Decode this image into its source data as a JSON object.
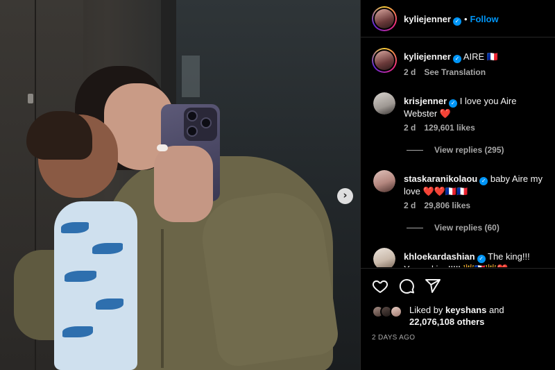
{
  "post": {
    "author": "kyliejenner",
    "follow_label": "Follow",
    "separator": "•",
    "verified_glyph": "✓",
    "caption": {
      "username": "kyliejenner",
      "text": "AIRE 🇫🇷",
      "age": "2 d",
      "translation_label": "See Translation"
    },
    "comments": [
      {
        "username": "krisjenner",
        "text": "I love you Aire Webster ❤️",
        "age": "2 d",
        "likes": "129,601 likes",
        "replies": "View replies (295)",
        "avatar_color": "#cfcac6"
      },
      {
        "username": "staskaranikolaou",
        "text": "baby Aire my love ❤️❤️🇫🇷🇫🇷",
        "age": "2 d",
        "likes": "29,806 likes",
        "replies": "View replies (60)",
        "avatar_color": "#b98b84"
      },
      {
        "username": "khloekardashian",
        "text": "The king!!! Young king!!!!! 👑🇫🇷👑❤️",
        "avatar_color": "#d9cfc6"
      }
    ],
    "liked_by_prefix": "Liked by",
    "liked_by_user": "keyshans",
    "liked_by_conj": "and",
    "others_count": "22,076,108 others",
    "time_ago": "2 DAYS AGO",
    "next_arrow": "›"
  },
  "icons": {
    "like": "heart-icon",
    "comment": "comment-icon",
    "share": "share-icon",
    "next": "chevron-right-icon"
  },
  "colors": {
    "accent": "#0095f6",
    "heart": "#ed4956",
    "muted": "#a8a8a8"
  }
}
